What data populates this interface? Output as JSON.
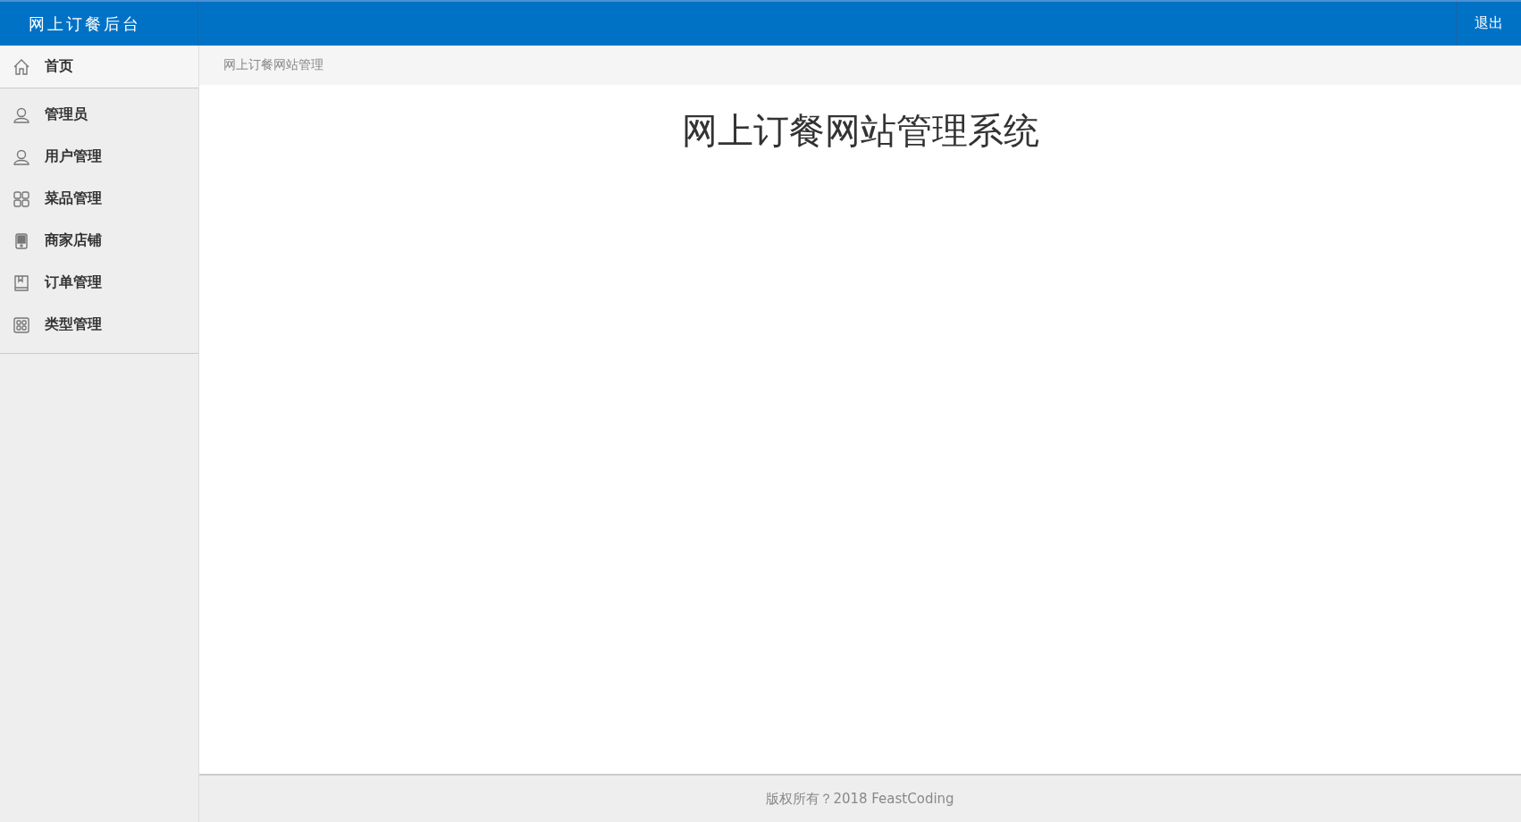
{
  "header": {
    "title": "网上订餐后台",
    "logout": "退出"
  },
  "sidebar": {
    "items": [
      {
        "label": "首页",
        "kind": "home",
        "selected": true
      },
      {
        "label": "管理员",
        "kind": "user",
        "selected": false
      },
      {
        "label": "用户管理",
        "kind": "user",
        "selected": false
      },
      {
        "label": "菜品管理",
        "kind": "grid",
        "selected": false
      },
      {
        "label": "商家店铺",
        "kind": "phone",
        "selected": false
      },
      {
        "label": "订单管理",
        "kind": "book",
        "selected": false
      },
      {
        "label": "类型管理",
        "kind": "boxgrid",
        "selected": false
      }
    ]
  },
  "breadcrumb": "网上订餐网站管理",
  "main": {
    "title": "网上订餐网站管理系统"
  },
  "footer": "版权所有？2018 FeastCoding"
}
